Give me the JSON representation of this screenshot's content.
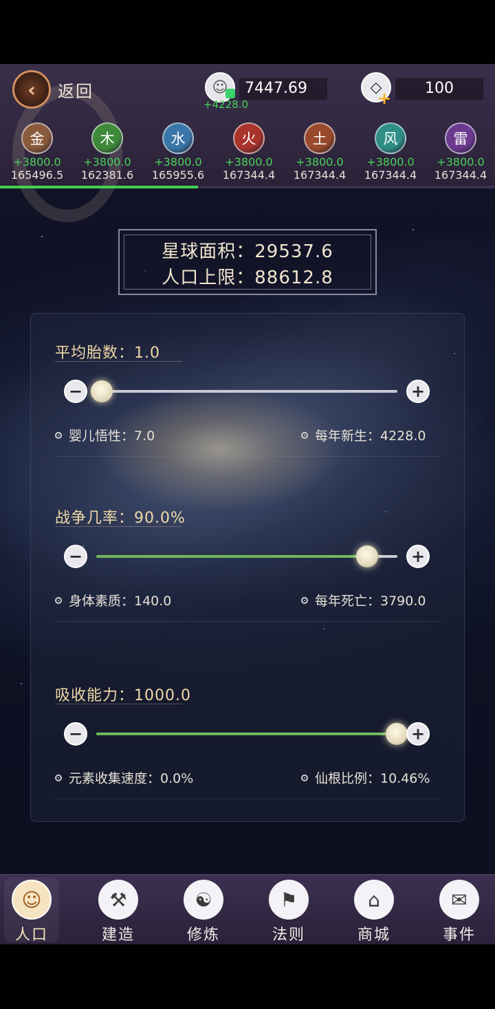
{
  "header": {
    "back_label": "返回",
    "population": {
      "value": "7447.69",
      "delta": "+4228.0"
    },
    "gems": {
      "value": "100"
    }
  },
  "elements": [
    {
      "glyph": "金",
      "delta": "+3800.0",
      "total": "165496.5",
      "color": "#8a5a3c"
    },
    {
      "glyph": "木",
      "delta": "+3800.0",
      "total": "162381.6",
      "color": "#3f8a3a"
    },
    {
      "glyph": "水",
      "delta": "+3800.0",
      "total": "165955.6",
      "color": "#3a77a8"
    },
    {
      "glyph": "火",
      "delta": "+3800.0",
      "total": "167344.4",
      "color": "#a8332b"
    },
    {
      "glyph": "土",
      "delta": "+3800.0",
      "total": "167344.4",
      "color": "#9a4a2c"
    },
    {
      "glyph": "风",
      "delta": "+3800.0",
      "total": "167344.4",
      "color": "#2f8f86"
    },
    {
      "glyph": "雷",
      "delta": "+3800.0",
      "total": "167344.4",
      "color": "#6b3a8f"
    }
  ],
  "element_progress": 0.4,
  "planet": {
    "area_line": "星球面积：29537.6",
    "cap_line": "人口上限：88612.8"
  },
  "controls": [
    {
      "label": "平均胎数：1.0",
      "level": 0.0,
      "stat_left": "婴儿悟性：7.0",
      "stat_right": "每年新生：4228.0"
    },
    {
      "label": "战争几率：90.0%",
      "level": 0.9,
      "stat_left": "身体素质：140.0",
      "stat_right": "每年死亡：3790.0"
    },
    {
      "label": "吸收能力：1000.0",
      "level": 1.0,
      "stat_left": "元素收集速度：0.0%",
      "stat_right": "仙根比例：10.46%"
    }
  ],
  "nav": [
    {
      "label": "人口",
      "icon": "people-icon",
      "active": true
    },
    {
      "label": "建造",
      "icon": "tools-icon",
      "active": false
    },
    {
      "label": "修炼",
      "icon": "meditation-icon",
      "active": false
    },
    {
      "label": "法则",
      "icon": "banner-icon",
      "active": false
    },
    {
      "label": "商城",
      "icon": "shop-icon",
      "active": false
    },
    {
      "label": "事件",
      "icon": "book-icon",
      "active": false
    }
  ],
  "colors": {
    "accent_green": "#3fd34e",
    "gold_text": "#f0d9a8"
  }
}
